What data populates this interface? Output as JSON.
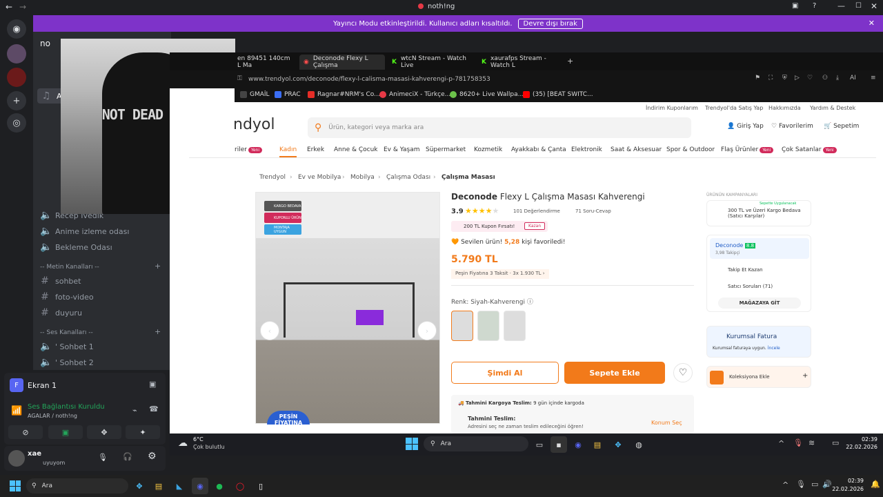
{
  "discord": {
    "window_title": "noth!ng",
    "streamer_banner": {
      "text": "Yayıncı Modu etkinleştirildi. Kullanıcı adları kısaltıldı.",
      "button": "Devre dışı bırak"
    },
    "server_name": "no",
    "channels": {
      "voice_top": [
        "Recep İvedik",
        "Anime izleme odası",
        "Bekleme Odası"
      ],
      "text_category": "-- Metin Kanalları --",
      "text": [
        "sohbet",
        "foto-video",
        "duyuru"
      ],
      "voice_category": "-- Ses Kanalları --",
      "voice": [
        "' Sohbet 1",
        "' Sohbet 2"
      ]
    },
    "ekran": {
      "title": "Ekran 1",
      "connection": "Ses Bağlantısı Kuruldu",
      "path": "AGALAR / noth!ng"
    },
    "user": {
      "name": "xae",
      "status": "uyuyom"
    }
  },
  "hoodie_text": "NOT DEAD YET",
  "browser": {
    "tabs": [
      "en 89451 140cm L Ma",
      "Deconode Flexy L Çalışma",
      "wtcN Stream - Watch Live",
      "xaurafps Stream - Watch L"
    ],
    "url": "www.trendyol.com/deconode/flexy-l-calisma-masasi-kahverengi-p-781758353",
    "bookmarks": [
      "GMAİL",
      "PRAC",
      "Ragnar#NRM's Co...",
      "AnimeciX - Türkçe...",
      "8620+ Live Wallpa...",
      "(35) [BEAT SWITC..."
    ]
  },
  "page": {
    "top_links": [
      "İndirim Kuponlarım",
      "Trendyol'da Satış Yap",
      "Hakkımızda",
      "Yardım & Destek"
    ],
    "logo": "ndyol",
    "search_placeholder": "Ürün, kategori veya marka ara",
    "account": [
      "Giriş Yap",
      "Favorilerim",
      "Sepetim"
    ],
    "categories": [
      "riler",
      "Kadın",
      "Erkek",
      "Anne & Çocuk",
      "Ev & Yaşam",
      "Süpermarket",
      "Kozmetik",
      "Ayakkabı & Çanta",
      "Elektronik",
      "Saat & Aksesuar",
      "Spor & Outdoor",
      "Flaş Ürünler",
      "Çok Satanlar"
    ],
    "new_label": "Yeni",
    "breadcrumb": [
      "Trendyol",
      "Ev ve Mobilya",
      "Mobilya",
      "Çalışma Odası",
      "Çalışma Masası"
    ],
    "badges": [
      "KARGO BEDAVA",
      "KUPONLU ÜRÜN",
      "MONTAJA UYGUN"
    ],
    "brand": "Deconode",
    "product": "Flexy L Çalışma Masası Kahverengi",
    "rating": "3.9",
    "reviews": "101 Değerlendirme",
    "qa": "71 Soru-Cevap",
    "coupon": "200 TL Kupon Fırsatı!",
    "coupon_btn": "Kazan",
    "fav_text": "Sevilen ürün!",
    "fav_count": "5,28",
    "fav_suffix": "kişi favoriledi!",
    "price": "5.790 TL",
    "installment": "Peşin Fiyatına 3 Taksit",
    "installment_detail": "3x 1.930 TL",
    "color_label": "Renk:",
    "color_value": "Siyah-Kahverengi",
    "buy_now": "Şimdi Al",
    "add_cart": "Sepete Ekle",
    "shipping_label": "Tahmini Kargoya Teslim:",
    "shipping_value": "9 gün içinde kargoda",
    "delivery_label": "Tahmini Teslim:",
    "delivery_value": "Adresini seç ne zaman teslim edileceğini öğren!",
    "location_btn": "Konum Seç",
    "sticker": "PEŞİN FİYATINA",
    "campaign_header": "ÜRÜNÜN KAMPANYALARI",
    "campaign_tag": "Sepette Uygulanacak",
    "campaign": "300 TL ve Üzeri Kargo Bedava (Satıcı Karşılar)",
    "seller": "Deconode",
    "seller_score": "8.8",
    "followers": "3,98 Takipçi",
    "follow": "Takip Et Kazan",
    "seller_q": "Satıcı Soruları (71)",
    "store_btn": "MAĞAZAYA GİT",
    "invoice_title": "Kurumsal Fatura",
    "invoice_text": "Kurumsal faturaya uygun.",
    "invoice_link": "İncele",
    "collection": "Koleksiyona Ekle"
  },
  "taskbar_inner": {
    "temp": "6°C",
    "weather": "Çok bulutlu",
    "search": "Ara",
    "time": "02:39",
    "date": "22.02.2026"
  },
  "taskbar_outer": {
    "search": "Ara",
    "time": "02:39",
    "date": "22.02.2026"
  }
}
